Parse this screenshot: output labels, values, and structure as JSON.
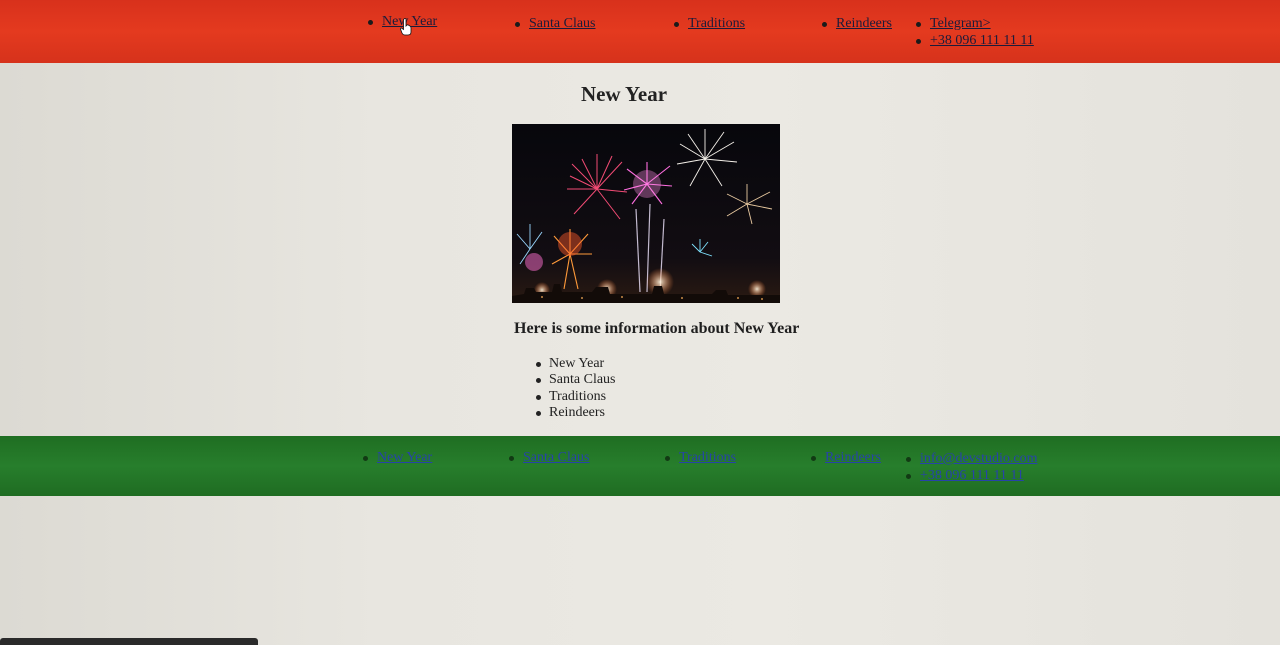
{
  "header_nav": {
    "items": [
      {
        "label": "New Year"
      },
      {
        "label": "Santa Claus"
      },
      {
        "label": "Traditions"
      },
      {
        "label": "Reindeers"
      }
    ],
    "contacts": [
      {
        "label": "Telegram>"
      },
      {
        "label": "+38 096 111 11 11"
      }
    ]
  },
  "main": {
    "title": "New Year",
    "info_heading": "Here is some information about New Year",
    "list": [
      "New Year",
      "Santa Claus",
      "Traditions",
      "Reindeers"
    ]
  },
  "footer_nav": {
    "items": [
      {
        "label": "New Year"
      },
      {
        "label": "Santa Claus"
      },
      {
        "label": "Traditions"
      },
      {
        "label": "Reindeers"
      }
    ],
    "contacts": [
      {
        "label": "info@devstudio.com"
      },
      {
        "label": "+38 096 111 11 11"
      }
    ]
  },
  "colors": {
    "header_bg": "#e03a1f",
    "footer_bg": "#247a29",
    "page_bg": "#e8e6e0",
    "footer_link": "#2743a8"
  }
}
